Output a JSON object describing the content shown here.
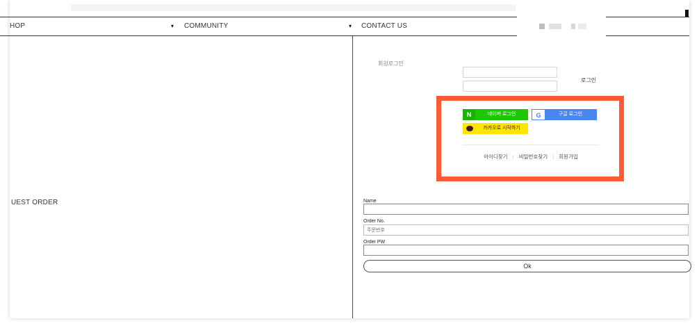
{
  "nav": {
    "shop_label": "HOP",
    "community_label": "COMMUNITY",
    "contact_label": "CONTACT US",
    "caret": "▾"
  },
  "login": {
    "section_label": "회원로그인",
    "login_button": "로그인"
  },
  "social": {
    "naver_logo": "N",
    "naver_label": "네이버 로그인",
    "google_logo": "G",
    "google_label": "구글 로그인",
    "kakao_label": "카카오로 시작하기"
  },
  "links": {
    "find_id": "아이디찾기",
    "find_pw": "비밀번호찾기",
    "signup": "회원가입",
    "separator": "|"
  },
  "guest_order": {
    "title": "UEST ORDER",
    "name_label": "Name",
    "order_no_label": "Order No.",
    "order_no_placeholder": "주문번호",
    "order_pw_label": "Order PW",
    "ok_label": "Ok"
  },
  "colors": {
    "highlight": "#ff5a36",
    "naver": "#1ec800",
    "google": "#4a86f0",
    "kakao": "#fee500"
  }
}
